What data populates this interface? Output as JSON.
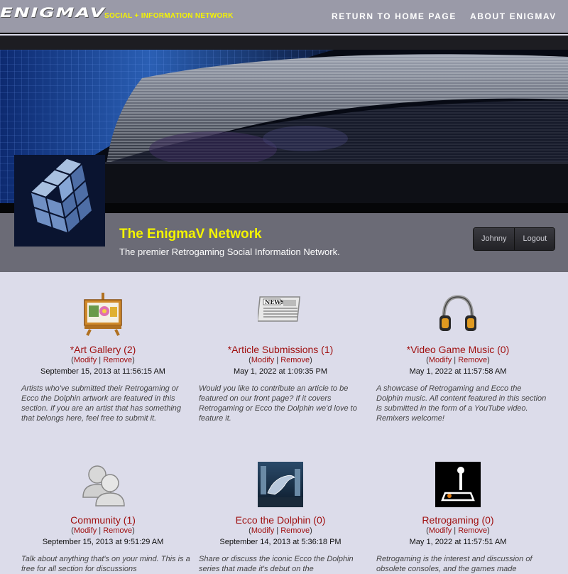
{
  "header": {
    "logo_text": "ENIGMAV",
    "tagline": "SOCIAL + INFORMATION NETWORK",
    "nav": {
      "home": "RETURN TO HOME PAGE",
      "about": "ABOUT ENIGMAV"
    }
  },
  "profile": {
    "title": "The EnigmaV Network",
    "subtitle": "The premier Retrogaming Social Information Network.",
    "user_button": "Johnny",
    "logout_button": "Logout"
  },
  "sections": [
    {
      "icon": "easel-painting-icon",
      "name": "*Art Gallery (2)",
      "modify": "Modify",
      "remove": "Remove",
      "date": "September 15, 2013 at 11:56:15 AM",
      "description": "Artists who've submitted their Retrogaming or Ecco the Dolphin artwork are featured in this section. If you are an artist that has something that belongs here, feel free to submit it."
    },
    {
      "icon": "newspaper-icon",
      "name": "*Article Submissions (1)",
      "modify": "Modify",
      "remove": "Remove",
      "date": "May 1, 2022 at 1:09:35 PM",
      "description": "Would you like to contribute an article to be featured on our front page? If it covers Retrogaming or Ecco the Dolphin we'd love to feature it."
    },
    {
      "icon": "headphones-icon",
      "name": "*Video Game Music (0)",
      "modify": "Modify",
      "remove": "Remove",
      "date": "May 1, 2022 at 11:57:58 AM",
      "description": "A showcase of Retrogaming and Ecco the Dolphin music. All content featured in this section is submitted in the form of a YouTube video. Remixers welcome!"
    },
    {
      "icon": "users-icon",
      "name": "Community (1)",
      "modify": "Modify",
      "remove": "Remove",
      "date": "September 15, 2013 at 9:51:29 AM",
      "description": "Talk about anything that's on your mind. This is a free for all section for discussions"
    },
    {
      "icon": "dolphin-icon",
      "name": "Ecco the Dolphin (0)",
      "modify": "Modify",
      "remove": "Remove",
      "date": "September 14, 2013 at 5:36:18 PM",
      "description": "Share or discuss the iconic Ecco the Dolphin series that made it's debut on the"
    },
    {
      "icon": "joystick-icon",
      "name": "Retrogaming (0)",
      "modify": "Modify",
      "remove": "Remove",
      "date": "May 1, 2022 at 11:57:51 AM",
      "description": "Retrogaming is the interest and discussion of obsolete consoles, and the games made"
    }
  ],
  "colors": {
    "accent_yellow": "#f4f400",
    "link_red": "#a01010",
    "topbar": "#9a9aa8",
    "page_bg": "#dcdcea"
  }
}
